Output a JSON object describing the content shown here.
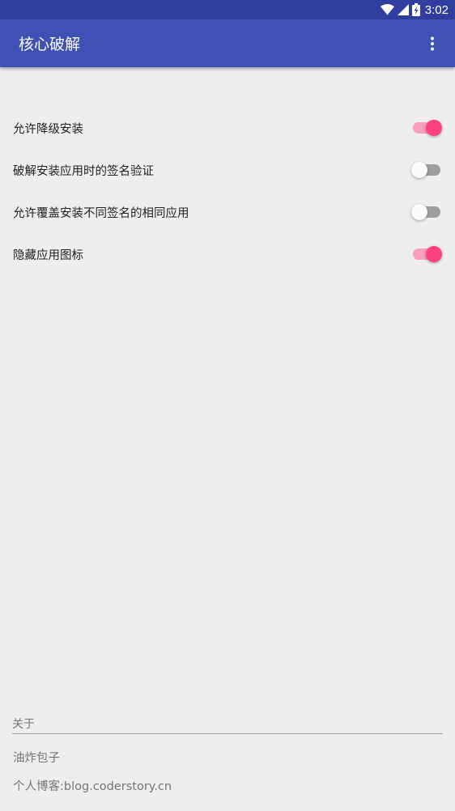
{
  "status_bar": {
    "time": "3:02",
    "icons": [
      "wifi-icon",
      "signal-icon",
      "battery-charging-icon"
    ]
  },
  "app_bar": {
    "title": "核心破解",
    "menu_icon": "more-vert-icon"
  },
  "settings": [
    {
      "label": "允许降级安装",
      "enabled": true
    },
    {
      "label": "破解安装应用时的签名验证",
      "enabled": false
    },
    {
      "label": "允许覆盖安装不同签名的相同应用",
      "enabled": false
    },
    {
      "label": "隐藏应用图标",
      "enabled": true
    }
  ],
  "about": {
    "header": "关于",
    "items": [
      "油炸包子",
      "个人博客:blog.coderstory.cn"
    ]
  },
  "colors": {
    "primary": "#3F51B5",
    "primary_dark": "#303F9F",
    "accent": "#FF4081",
    "background": "#EEEEEE"
  }
}
